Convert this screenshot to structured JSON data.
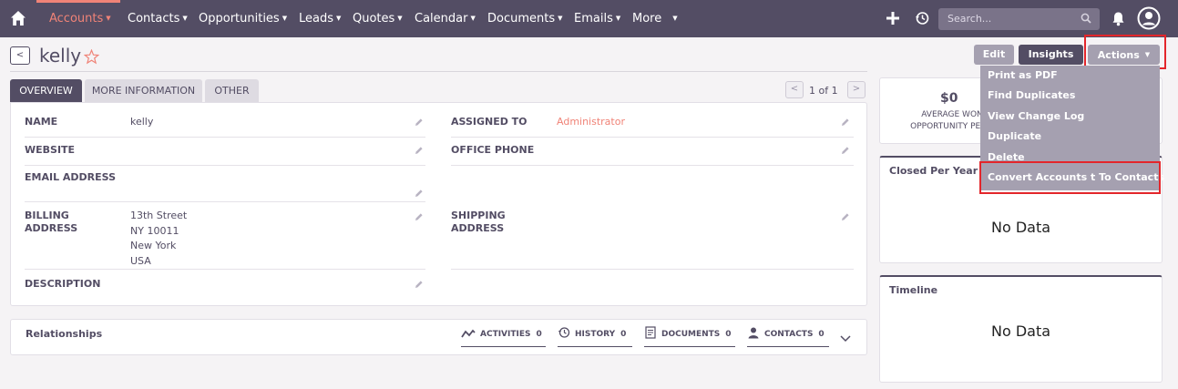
{
  "nav": {
    "tabs": [
      {
        "label": "Accounts",
        "active": true
      },
      {
        "label": "Contacts"
      },
      {
        "label": "Opportunities"
      },
      {
        "label": "Leads"
      },
      {
        "label": "Quotes"
      },
      {
        "label": "Calendar"
      },
      {
        "label": "Documents"
      },
      {
        "label": "Emails"
      },
      {
        "label": "More"
      }
    ],
    "search_placeholder": "Search...",
    "accent": "#f08377",
    "bar_color": "#534d64"
  },
  "record": {
    "title": "kelly",
    "edit_label": "Edit",
    "insights_label": "Insights",
    "actions_label": "Actions"
  },
  "actions_menu": [
    "Print as PDF",
    "Find Duplicates",
    "View Change Log",
    "Duplicate",
    "Delete",
    "Convert Accounts t To Contacts"
  ],
  "tabs": [
    "OVERVIEW",
    "MORE INFORMATION",
    "OTHER"
  ],
  "pagination": "1 of 1",
  "fields": {
    "name_label": "NAME",
    "name_value": "kelly",
    "assigned_label": "ASSIGNED TO",
    "assigned_value": "Administrator",
    "website_label": "WEBSITE",
    "office_phone_label": "OFFICE PHONE",
    "email_label": "EMAIL ADDRESS",
    "billing_label_1": "BILLING",
    "billing_label_2": "ADDRESS",
    "billing_lines": [
      "13th Street",
      "NY 10011",
      "New York",
      "USA"
    ],
    "shipping_label_1": "SHIPPING",
    "shipping_label_2": "ADDRESS",
    "description_label": "DESCRIPTION"
  },
  "relationships": {
    "title": "Relationships",
    "items": [
      {
        "label": "ACTIVITIES",
        "count": "0",
        "icon": "activity-icon"
      },
      {
        "label": "HISTORY",
        "count": "0",
        "icon": "history-icon"
      },
      {
        "label": "DOCUMENTS",
        "count": "0",
        "icon": "documents-icon"
      },
      {
        "label": "CONTACTS",
        "count": "0",
        "icon": "contact-icon"
      }
    ]
  },
  "dashlets": {
    "won_value": "$0",
    "won_sub_1": "AVERAGE WON",
    "won_sub_2": "OPPORTUNITY PER Y",
    "closed_title": "Closed Per Year",
    "closed_nodata": "No Data",
    "timeline_title": "Timeline",
    "timeline_nodata": "No Data"
  }
}
